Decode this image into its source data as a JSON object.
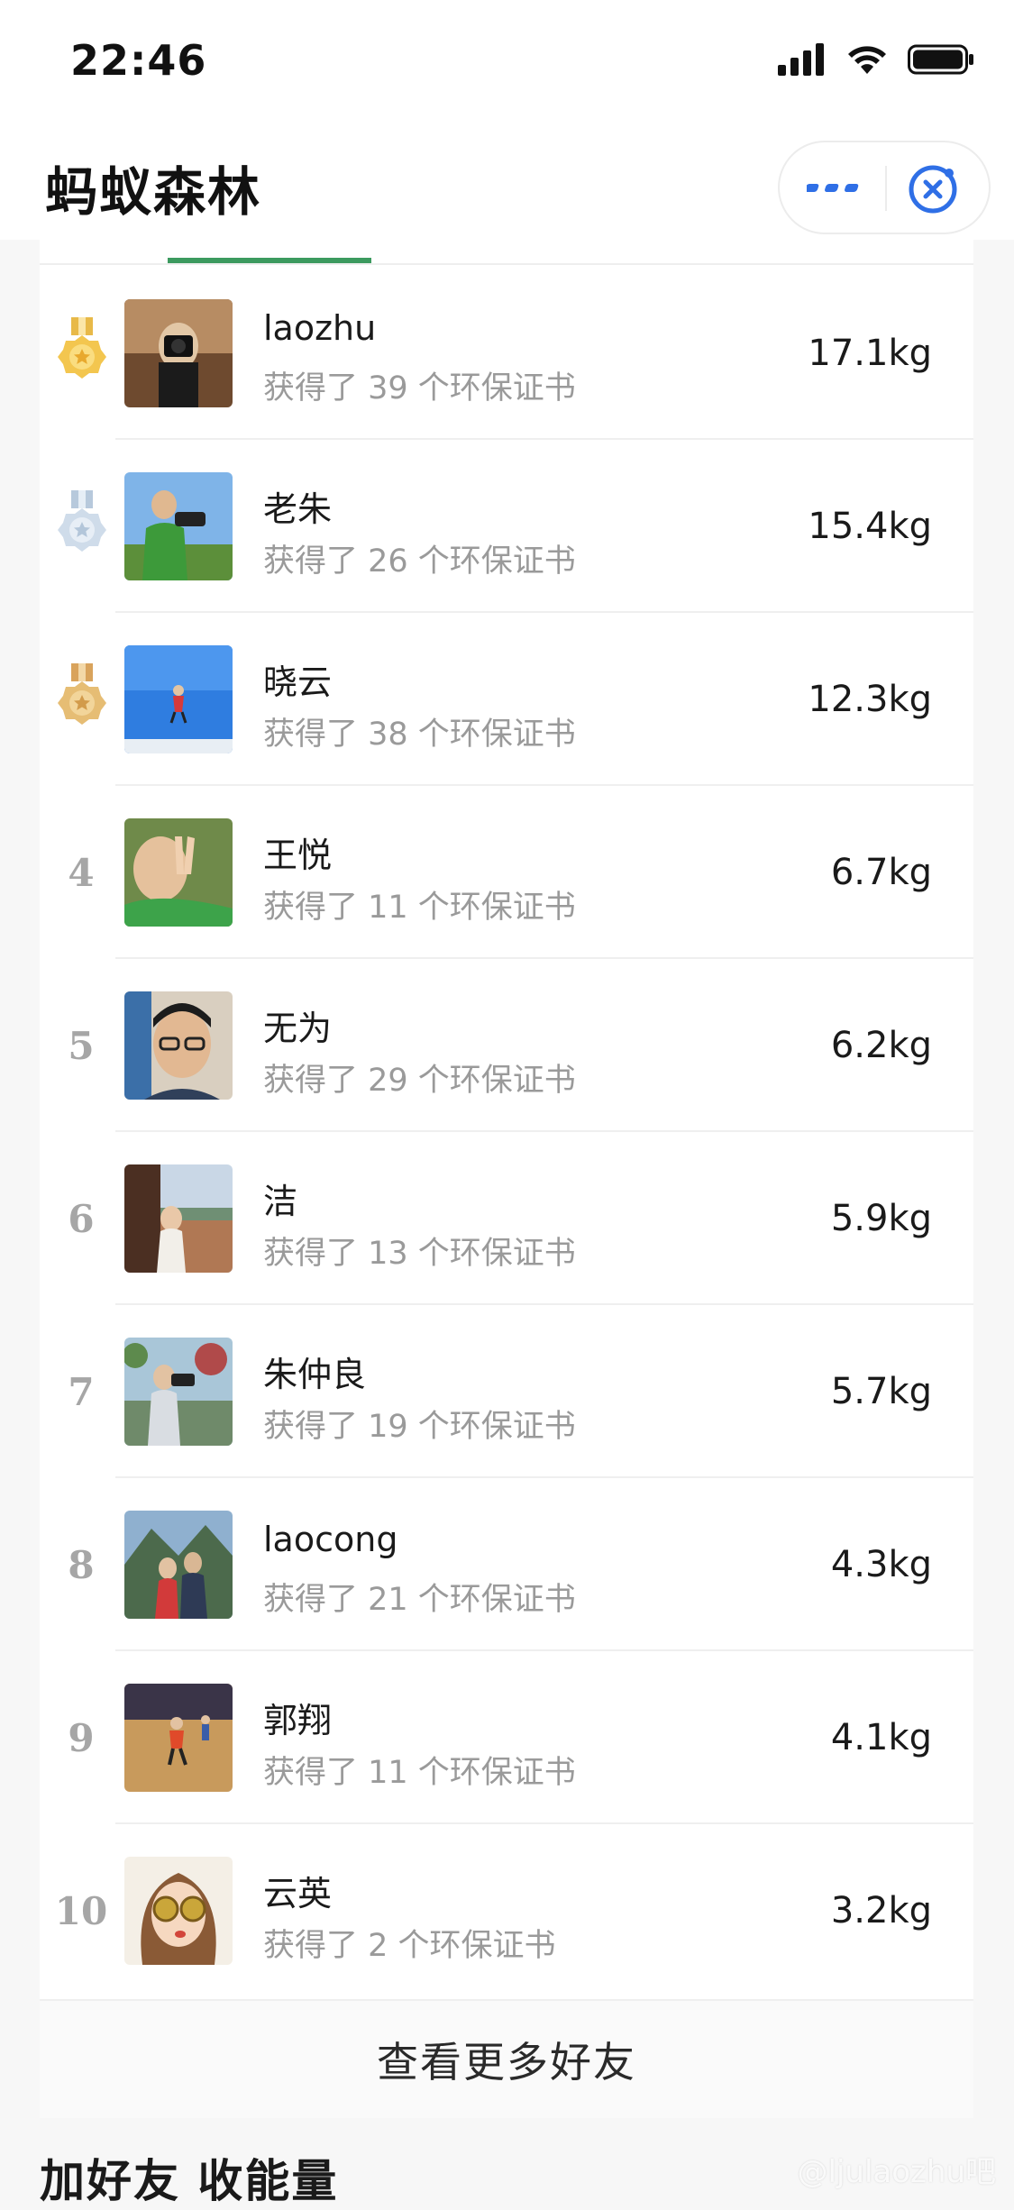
{
  "status_bar": {
    "time": "22:46",
    "icons": [
      "signal-icon",
      "wifi-icon",
      "battery-icon"
    ]
  },
  "title_bar": {
    "title": "蚂蚁森林",
    "more_icon": "more-icon",
    "close_icon": "close-icon",
    "accent_color": "#2f6fe6"
  },
  "colors": {
    "tab_indicator": "#3c9a5f",
    "gold_medal": "#e8b948",
    "silver_medal": "#c8d7e6",
    "bronze_medal": "#e0b368",
    "rank_number": "#a6a6a6"
  },
  "ranking": [
    {
      "rank": "1",
      "medal": "gold",
      "name": "laozhu",
      "certificates": "获得了 39 个环保证书",
      "energy": "17.1kg"
    },
    {
      "rank": "2",
      "medal": "silver",
      "name": "老朱",
      "certificates": "获得了 26 个环保证书",
      "energy": "15.4kg"
    },
    {
      "rank": "3",
      "medal": "bronze",
      "name": "晓云",
      "certificates": "获得了 38 个环保证书",
      "energy": "12.3kg"
    },
    {
      "rank": "4",
      "name": "王悦",
      "certificates": "获得了 11 个环保证书",
      "energy": "6.7kg"
    },
    {
      "rank": "5",
      "name": "无为",
      "certificates": "获得了 29 个环保证书",
      "energy": "6.2kg"
    },
    {
      "rank": "6",
      "name": "洁",
      "certificates": "获得了 13 个环保证书",
      "energy": "5.9kg"
    },
    {
      "rank": "7",
      "name": "朱仲良",
      "certificates": "获得了 19 个环保证书",
      "energy": "5.7kg"
    },
    {
      "rank": "8",
      "name": "laocong",
      "certificates": "获得了 21 个环保证书",
      "energy": "4.3kg"
    },
    {
      "rank": "9",
      "name": "郭翔",
      "certificates": "获得了 11 个环保证书",
      "energy": "4.1kg"
    },
    {
      "rank": "10",
      "name": "云英",
      "certificates": "获得了 2 个环保证书",
      "energy": "3.2kg"
    }
  ],
  "more_friends_label": "查看更多好友",
  "section_title": "加好友 收能量",
  "watermark": "@ljulaozhu吧"
}
